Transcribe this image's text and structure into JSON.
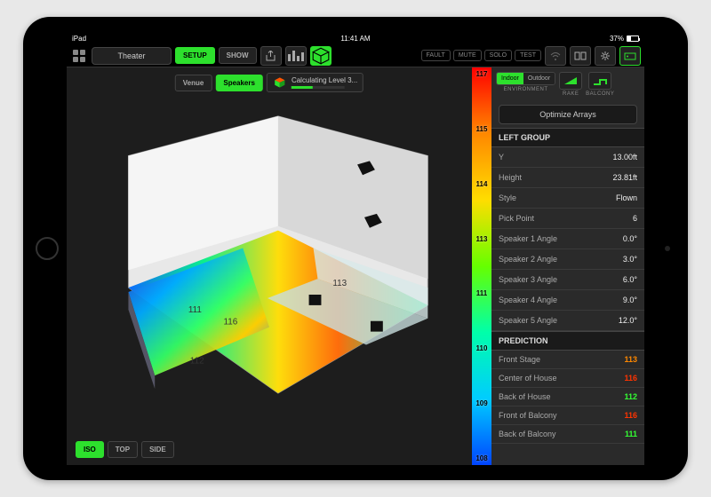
{
  "status": {
    "device": "iPad",
    "time": "11:41 AM",
    "battery_pct": "37%"
  },
  "toolbar": {
    "project_name": "Theater",
    "setup": "SETUP",
    "show": "SHOW",
    "fault": "FAULT",
    "mute": "MUTE",
    "solo": "SOLO",
    "test": "TEST"
  },
  "secondary": {
    "venue": "Venue",
    "speakers": "Speakers",
    "calc_status": "Calculating Level 3..."
  },
  "view_tabs": {
    "iso": "ISO",
    "top": "TOP",
    "side": "SIDE"
  },
  "color_scale": [
    "117",
    "115",
    "114",
    "113",
    "111",
    "110",
    "109",
    "108"
  ],
  "panel": {
    "env": {
      "indoor": "Indoor",
      "outdoor": "Outdoor",
      "label": "ENVIRONMENT"
    },
    "rake_label": "RAKE",
    "balcony_label": "BALCONY",
    "optimize": "Optimize Arrays",
    "group_header": "LEFT GROUP",
    "props": [
      {
        "label": "Y",
        "value": "13.00ft"
      },
      {
        "label": "Height",
        "value": "23.81ft"
      },
      {
        "label": "Style",
        "value": "Flown"
      },
      {
        "label": "Pick Point",
        "value": "6"
      },
      {
        "label": "Speaker 1 Angle",
        "value": "0.0°"
      },
      {
        "label": "Speaker 2 Angle",
        "value": "3.0°"
      },
      {
        "label": "Speaker 3 Angle",
        "value": "6.0°"
      },
      {
        "label": "Speaker 4 Angle",
        "value": "9.0°"
      },
      {
        "label": "Speaker 5 Angle",
        "value": "12.0°"
      }
    ],
    "prediction_header": "PREDICTION",
    "predictions": [
      {
        "label": "Front Stage",
        "value": "113",
        "color": "#ff8800"
      },
      {
        "label": "Center of House",
        "value": "116",
        "color": "#ff3300"
      },
      {
        "label": "Back of House",
        "value": "112",
        "color": "#33ff33"
      },
      {
        "label": "Front of Balcony",
        "value": "116",
        "color": "#ff3300"
      },
      {
        "label": "Back of Balcony",
        "value": "111",
        "color": "#33ff33"
      }
    ]
  }
}
